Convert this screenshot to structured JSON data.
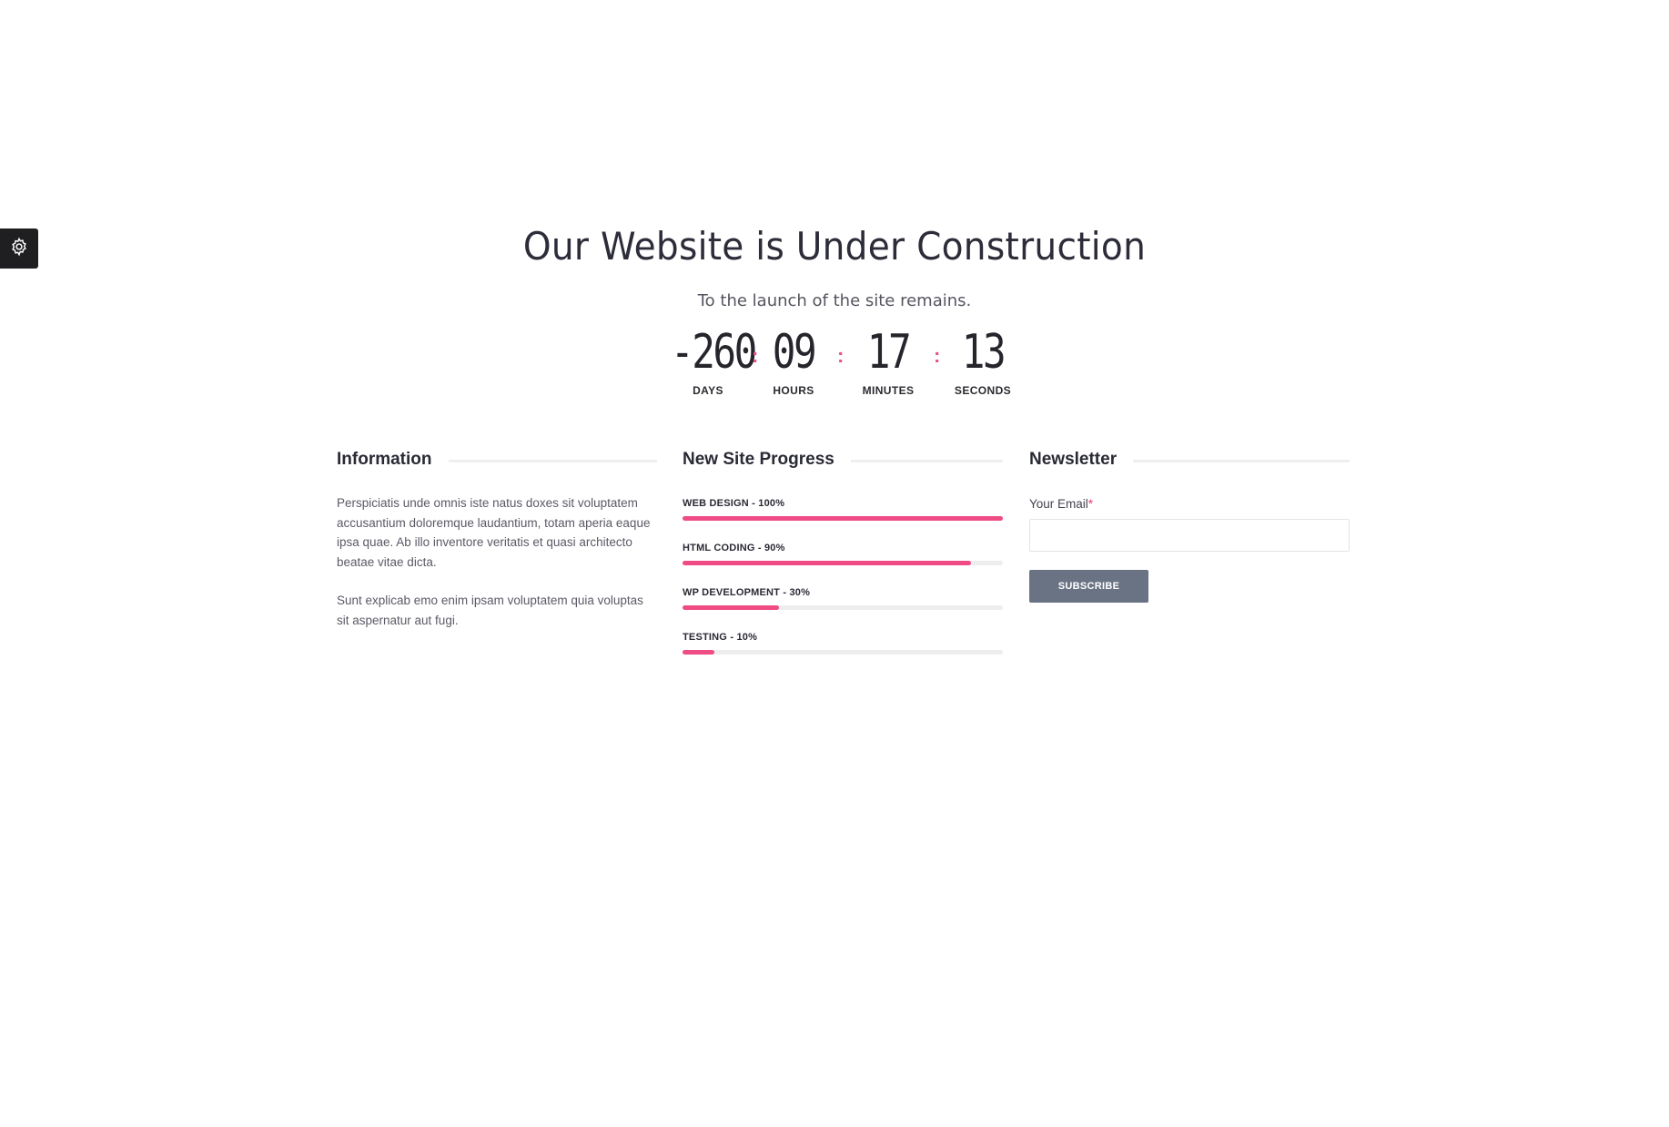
{
  "header": {
    "title": "Our Website is Under Construction",
    "subtitle": "To the launch of the site remains."
  },
  "countdown": {
    "days": "-260",
    "hours": "09",
    "minutes": "17",
    "seconds": "13",
    "days_label": "DAYS",
    "hours_label": "HOURS",
    "minutes_label": "MINUTES",
    "seconds_label": "SECONDS",
    "separator": ":"
  },
  "information": {
    "title": "Information",
    "paragraphs": [
      "Perspiciatis unde omnis iste natus doxes sit voluptatem accusantium doloremque laudantium, totam aperia eaque ipsa quae. Ab illo inventore veritatis et quasi architecto beatae vitae dicta.",
      "Sunt explicab emo enim ipsam voluptatem quia voluptas sit aspernatur aut fugi."
    ]
  },
  "progress": {
    "title": "New Site Progress",
    "items": [
      {
        "label": "WEB DESIGN - 100%",
        "value": 100
      },
      {
        "label": "HTML CODING - 90%",
        "value": 90
      },
      {
        "label": "WP DEVELOPMENT - 30%",
        "value": 30
      },
      {
        "label": "TESTING - 10%",
        "value": 10
      }
    ]
  },
  "newsletter": {
    "title": "Newsletter",
    "email_label": "Your Email",
    "required_mark": "*",
    "email_value": "",
    "button_label": "SUBSCRIBE"
  },
  "icons": {
    "settings": "gear-icon"
  },
  "colors": {
    "accent": "#ef4b84",
    "button": "#6a7384",
    "settings_bg": "#1f1f22"
  }
}
